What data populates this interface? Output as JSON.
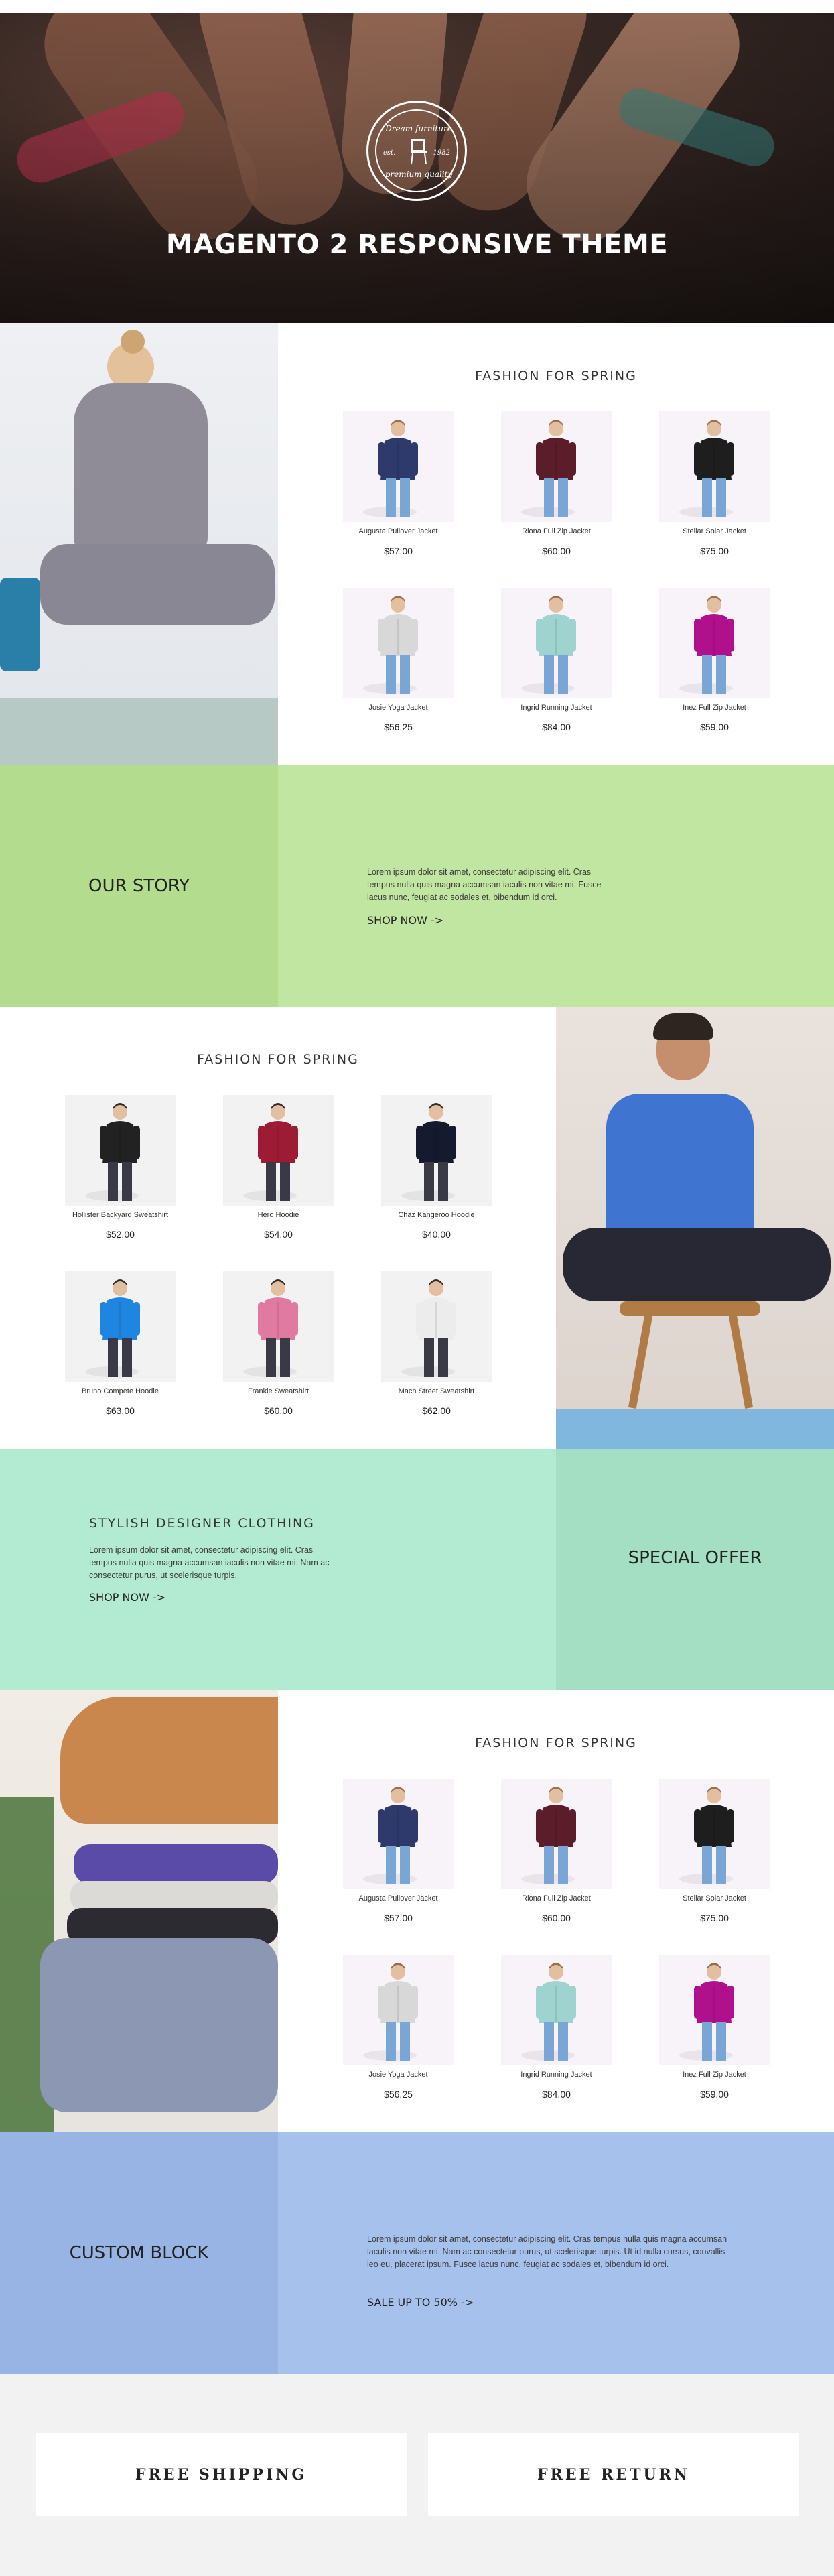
{
  "hero": {
    "logo_top": "Dream furniture",
    "logo_bottom": "premium quality",
    "logo_est": "est.",
    "logo_year": "1982",
    "title": "MAGENTO 2 RESPONSIVE THEME"
  },
  "section1": {
    "title": "FASHION FOR SPRING",
    "products": [
      {
        "name": "Augusta Pullover Jacket",
        "price": "$57.00",
        "color": "#2d3a6b"
      },
      {
        "name": "Riona Full Zip Jacket",
        "price": "$60.00",
        "color": "#5b1d2a"
      },
      {
        "name": "Stellar Solar Jacket",
        "price": "$75.00",
        "color": "#1e1e1e"
      },
      {
        "name": "Josie Yoga Jacket",
        "price": "$56.25",
        "color": "#d8d8d8"
      },
      {
        "name": "Ingrid Running Jacket",
        "price": "$84.00",
        "color": "#9fd3cf"
      },
      {
        "name": "Inez Full Zip Jacket",
        "price": "$59.00",
        "color": "#b0108c"
      }
    ]
  },
  "story": {
    "title": "OUR STORY",
    "text": "Lorem ipsum dolor sit amet, consectetur adipiscing elit. Cras tempus nulla quis magna accumsan iaculis non vitae mi. Fusce lacus nunc, feugiat ac sodales et, bibendum id orci.",
    "link": "SHOP NOW ->"
  },
  "section2": {
    "title": "FASHION FOR SPRING",
    "products": [
      {
        "name": "Hollister Backyard Sweatshirt",
        "price": "$52.00",
        "color": "#222222"
      },
      {
        "name": "Hero Hoodie",
        "price": "$54.00",
        "color": "#9e1b35"
      },
      {
        "name": "Chaz Kangeroo Hoodie",
        "price": "$40.00",
        "color": "#151a2e"
      },
      {
        "name": "Bruno Compete Hoodie",
        "price": "$63.00",
        "color": "#1e86e0"
      },
      {
        "name": "Frankie Sweatshirt",
        "price": "$60.00",
        "color": "#e07aa0"
      },
      {
        "name": "Mach Street Sweatshirt",
        "price": "$62.00",
        "color": "#ececec"
      }
    ]
  },
  "offer": {
    "heading": "STYLISH DESIGNER CLOTHING",
    "text": "Lorem ipsum dolor sit amet, consectetur adipiscing elit. Cras tempus nulla quis magna accumsan iaculis non vitae mi. Nam ac consectetur purus, ut scelerisque turpis.",
    "link": "SHOP NOW ->",
    "title": "SPECIAL OFFER"
  },
  "section3": {
    "title": "FASHION FOR SPRING",
    "products": [
      {
        "name": "Augusta Pullover Jacket",
        "price": "$57.00",
        "color": "#2d3a6b"
      },
      {
        "name": "Riona Full Zip Jacket",
        "price": "$60.00",
        "color": "#5b1d2a"
      },
      {
        "name": "Stellar Solar Jacket",
        "price": "$75.00",
        "color": "#1e1e1e"
      },
      {
        "name": "Josie Yoga Jacket",
        "price": "$56.25",
        "color": "#d8d8d8"
      },
      {
        "name": "Ingrid Running Jacket",
        "price": "$84.00",
        "color": "#9fd3cf"
      },
      {
        "name": "Inez Full Zip Jacket",
        "price": "$59.00",
        "color": "#b0108c"
      }
    ]
  },
  "custom": {
    "title": "CUSTOM BLOCK",
    "text": "Lorem ipsum dolor sit amet, consectetur adipiscing elit. Cras tempus nulla quis magna accumsan iaculis non vitae mi. Nam ac consectetur purus, ut scelerisque turpis. Ut id nulla cursus, convallis leo eu, placerat ipsum. Fusce lacus nunc, feugiat ac sodales et, bibendum id orci.",
    "link": "SALE UP TO 50% ->"
  },
  "features": {
    "left": "FREE SHIPPING",
    "right": "FREE RETURN"
  },
  "colors": {
    "green_dark": "#b3dc8f",
    "green_light": "#c1e6a1",
    "mint_light": "#b2ebd1",
    "mint_dark": "#a4dfc3",
    "blue_dark": "#98b4e4",
    "blue_light": "#a6c1ec",
    "card_bg_women": "#f8f2f9",
    "card_bg_men": "#f2f2f2"
  }
}
